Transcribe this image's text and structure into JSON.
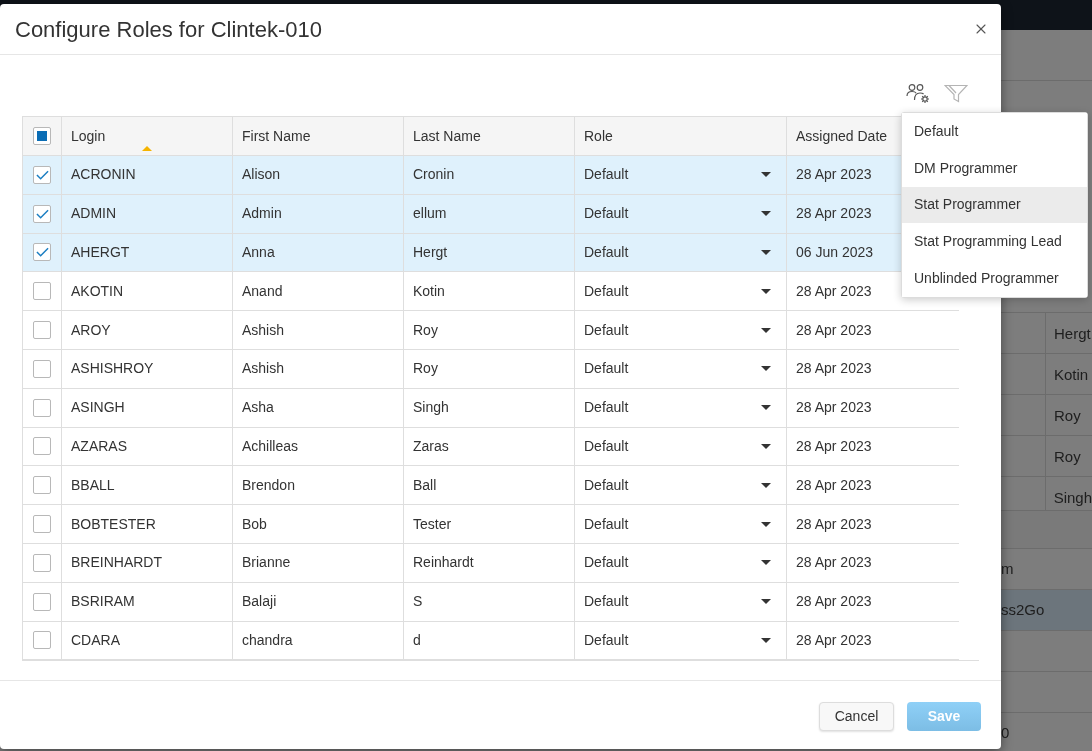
{
  "background_table": {
    "cells": [
      "Hergt",
      "Kotin",
      "Roy",
      "Roy",
      "Singh"
    ]
  },
  "background_list": {
    "rows": [
      {
        "text": "m",
        "selected": false
      },
      {
        "text": "ss2Go",
        "selected": true
      },
      {
        "selected": false
      },
      {
        "selected": false
      },
      {
        "text": "0",
        "selected": false
      }
    ]
  },
  "dialog": {
    "title": "Configure Roles for Clintek-010",
    "toolbar": [
      {
        "kind": "manage-users",
        "disabled": false
      },
      {
        "kind": "filter",
        "disabled": true
      }
    ],
    "table": {
      "select_all": {
        "checked": false,
        "indeterminate": true
      },
      "columns": [
        {
          "label": "Login",
          "sorted": true
        },
        {
          "label": "First Name",
          "sorted": false
        },
        {
          "label": "Last Name",
          "sorted": false
        },
        {
          "label": "Role",
          "sorted": false
        },
        {
          "label": "Assigned Date",
          "sorted": false
        }
      ],
      "rows": [
        {
          "login": "ACRONIN",
          "first_name": "Alison",
          "last_name": "Cronin",
          "role": "Default",
          "assigned_date": "28 Apr 2023",
          "selected": true
        },
        {
          "login": "ADMIN",
          "first_name": "Admin",
          "last_name": "ellum",
          "role": "Default",
          "assigned_date": "28 Apr 2023",
          "selected": true
        },
        {
          "login": "AHERGT",
          "first_name": "Anna",
          "last_name": "Hergt",
          "role": "Default",
          "assigned_date": "06 Jun 2023",
          "selected": true
        },
        {
          "login": "AKOTIN",
          "first_name": "Anand",
          "last_name": "Kotin",
          "role": "Default",
          "assigned_date": "28 Apr 2023",
          "selected": false
        },
        {
          "login": "AROY",
          "first_name": "Ashish",
          "last_name": "Roy",
          "role": "Default",
          "assigned_date": "28 Apr 2023",
          "selected": false
        },
        {
          "login": "ASHISHROY",
          "first_name": "Ashish",
          "last_name": "Roy",
          "role": "Default",
          "assigned_date": "28 Apr 2023",
          "selected": false
        },
        {
          "login": "ASINGH",
          "first_name": "Asha",
          "last_name": "Singh",
          "role": "Default",
          "assigned_date": "28 Apr 2023",
          "selected": false
        },
        {
          "login": "AZARAS",
          "first_name": "Achilleas",
          "last_name": "Zaras",
          "role": "Default",
          "assigned_date": "28 Apr 2023",
          "selected": false
        },
        {
          "login": "BBALL",
          "first_name": "Brendon",
          "last_name": "Ball",
          "role": "Default",
          "assigned_date": "28 Apr 2023",
          "selected": false
        },
        {
          "login": "BOBTESTER",
          "first_name": "Bob",
          "last_name": "Tester",
          "role": "Default",
          "assigned_date": "28 Apr 2023",
          "selected": false
        },
        {
          "login": "BREINHARDT",
          "first_name": "Brianne",
          "last_name": "Reinhardt",
          "role": "Default",
          "assigned_date": "28 Apr 2023",
          "selected": false
        },
        {
          "login": "BSRIRAM",
          "first_name": "Balaji",
          "last_name": "S",
          "role": "Default",
          "assigned_date": "28 Apr 2023",
          "selected": false
        },
        {
          "login": "CDARA",
          "first_name": "chandra",
          "last_name": "d",
          "role": "Default",
          "assigned_date": "28 Apr 2023",
          "selected": false
        }
      ]
    },
    "role_menu": {
      "options": [
        {
          "label": "Default",
          "highlighted": false
        },
        {
          "label": "DM Programmer",
          "highlighted": false
        },
        {
          "label": "Stat Programmer",
          "highlighted": true
        },
        {
          "label": "Stat Programming Lead",
          "highlighted": false
        },
        {
          "label": "Unblinded Programmer",
          "highlighted": false
        }
      ]
    },
    "buttons": [
      {
        "label": "Cancel",
        "kind": "secondary",
        "disabled": false
      },
      {
        "label": "Save",
        "kind": "primary",
        "disabled": true
      }
    ]
  }
}
